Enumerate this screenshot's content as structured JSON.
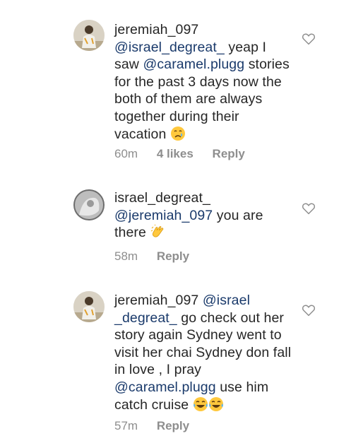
{
  "comments": [
    {
      "username": "jeremiah_097",
      "mention1": "@israel_degreat_",
      "text1": " yeap I saw ",
      "mention2": "@caramel.plugg",
      "text2": " stories for the past 3 days now the both of them are always together during their vacation ",
      "emoji": "crying-face",
      "time": "60m",
      "likes": "4 likes",
      "reply": "Reply"
    },
    {
      "username": "israel_degreat_",
      "mention1": "@jeremiah_097",
      "text1": " you are there ",
      "emoji": "clapping-hands",
      "time": "58m",
      "reply": "Reply"
    },
    {
      "username": "jeremiah_097",
      "mention1": "@israel _degreat_",
      "text1": " go check out her story again Sydney went to visit her chai Sydney don fall in love , I pray ",
      "mention2": "@caramel.plugg",
      "text2": "  use him catch cruise ",
      "emoji": "tears-of-joy x2",
      "time": "57m",
      "reply": "Reply"
    }
  ],
  "colors": {
    "text": "#262626",
    "mention": "#1a3a6b",
    "meta": "#8e8e8e"
  },
  "icons": {
    "like": "heart-outline-icon"
  }
}
